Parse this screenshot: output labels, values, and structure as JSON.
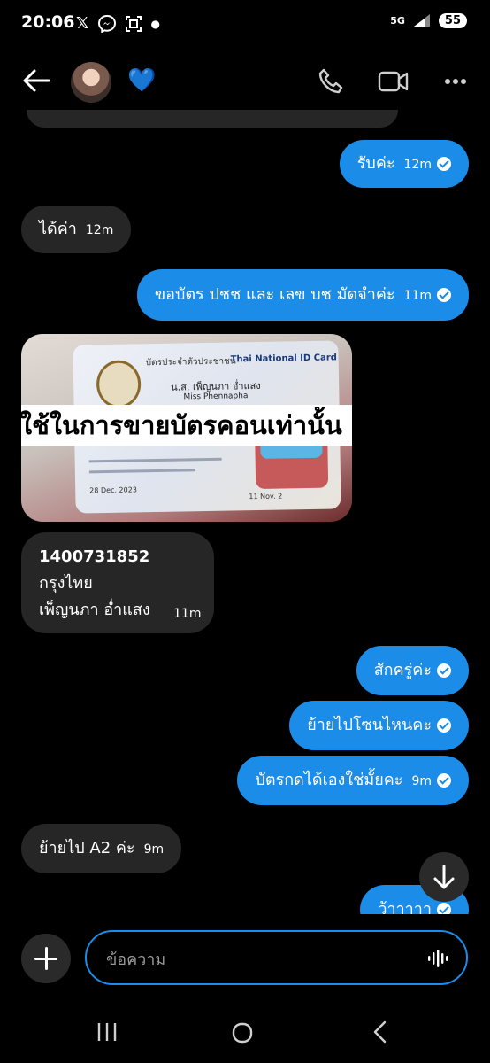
{
  "status_bar": {
    "time": "20:06",
    "icons_left": [
      "x-icon",
      "messenger-icon",
      "scan-icon"
    ],
    "signal": "5G",
    "battery": "55"
  },
  "header": {
    "heart_emoji": "💙"
  },
  "messages": [
    {
      "side": "out",
      "text": "รับค่ะ",
      "time": "12m",
      "seen": true
    },
    {
      "side": "in",
      "text": "ได้ค่า",
      "time": "12m"
    },
    {
      "side": "out",
      "text": "ขอบัตร ปชช และ เลข บช มัดจำค่ะ",
      "time": "11m",
      "seen": true
    },
    {
      "side": "in",
      "type": "image",
      "overlay_text": "ใช้ในการขายบัตรคอนเท่านั้น",
      "card_text": [
        "บัตรประจำตัวประชาชน",
        "Thai National ID Card",
        "น.ส. เพ็ญนภา อ่ำแสง",
        "Miss Phennapha",
        "28 Dec. 2023",
        "11 Nov. 2"
      ]
    },
    {
      "side": "in",
      "type": "account",
      "account_number": "1400731852",
      "bank": "กรุงไทย",
      "name": "เพ็ญนภา อ่ำแสง",
      "time": "11m"
    },
    {
      "side": "out",
      "text": "สักครู่ค่ะ",
      "seen": true
    },
    {
      "side": "out",
      "text": "ย้ายไปโซนไหนคะ",
      "seen": true
    },
    {
      "side": "out",
      "text": "บัตรกดได้เองใช่มั้ยคะ",
      "time": "9m",
      "seen": true
    },
    {
      "side": "in",
      "text": "ย้ายไป A2 ค่ะ",
      "time": "9m"
    },
    {
      "side": "out",
      "text": "ว้าาาาา",
      "seen": true
    }
  ],
  "composer": {
    "placeholder": "ข้อความ"
  },
  "colors": {
    "accent": "#1b8ce8",
    "incoming": "#262626",
    "background": "#000000"
  }
}
